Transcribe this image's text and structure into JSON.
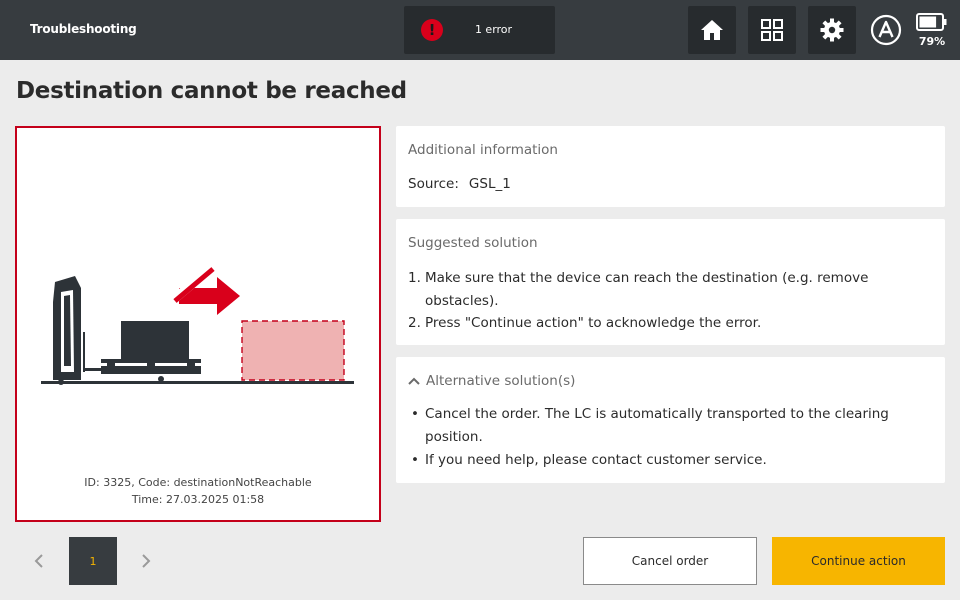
{
  "header": {
    "title": "Troubleshooting",
    "error_badge": {
      "label": "1 error",
      "icon": "alert-icon",
      "color": "#d9001b"
    },
    "buttons": [
      {
        "name": "home",
        "icon": "home-icon"
      },
      {
        "name": "apps",
        "icon": "grid-icon"
      },
      {
        "name": "settings",
        "icon": "gear-icon"
      }
    ],
    "mode_indicator": {
      "icon": "automatic-mode-icon",
      "letter": "A"
    },
    "battery": {
      "icon": "battery-icon",
      "percent": "79%",
      "level": 0.79
    }
  },
  "page": {
    "title": "Destination cannot be reached"
  },
  "illustration": {
    "id_line": "ID: 3325, Code: destinationNotReachable",
    "time_line": "Time: 27.03.2025 01:58",
    "border_color": "#c4001a",
    "target_fill": "#efb2b2"
  },
  "additional_info": {
    "title": "Additional information",
    "source_label": "Source:",
    "source_value": "GSL_1"
  },
  "suggested_solution": {
    "title": "Suggested solution",
    "steps": [
      {
        "num": "1.",
        "text": "Make sure that the device can reach the destination (e.g. remove obstacles)."
      },
      {
        "num": "2.",
        "text": "Press \"Continue action\" to acknowledge the error."
      }
    ]
  },
  "alternative_solution": {
    "title": "Alternative solution(s)",
    "icon": "chevron-up-icon",
    "items": [
      "Cancel the order. The LC is automatically transported to the clearing position.",
      "If you need help, please contact customer service."
    ]
  },
  "pagination": {
    "current": "1"
  },
  "actions": {
    "cancel_label": "Cancel order",
    "continue_label": "Continue action",
    "accent": "#f7b500"
  }
}
